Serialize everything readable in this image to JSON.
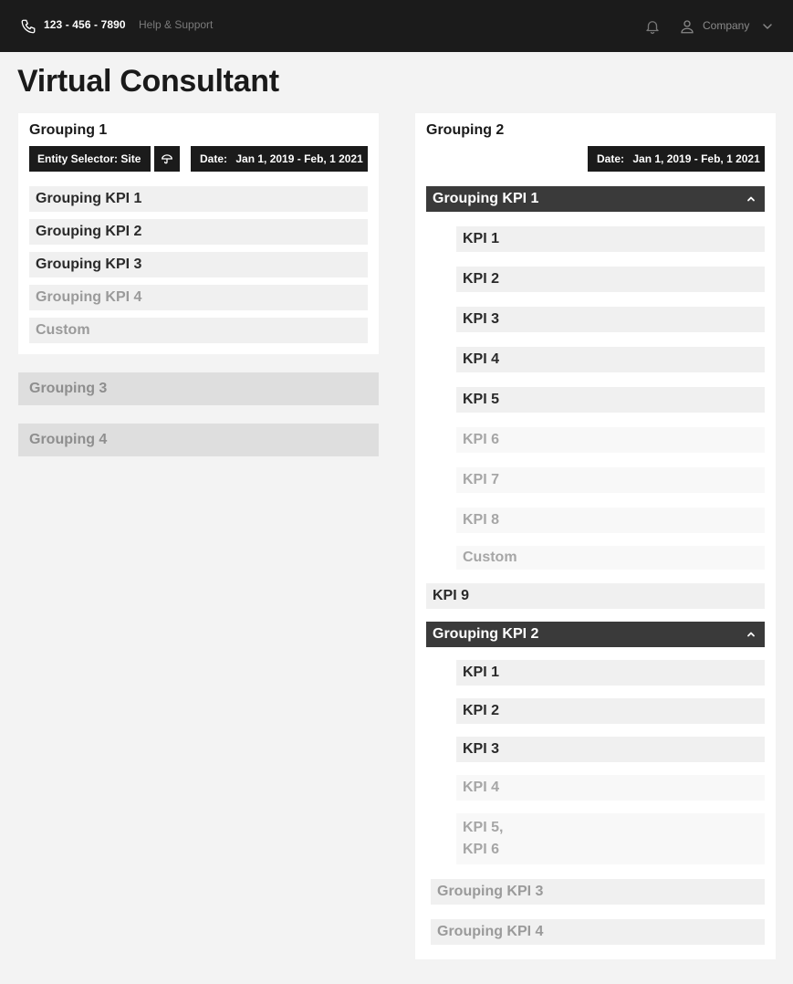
{
  "header": {
    "phone": "123 - 456 - 7890",
    "help": "Help & Support",
    "company": "Company"
  },
  "page": {
    "title": "Virtual Consultant"
  },
  "grouping1": {
    "title": "Grouping 1",
    "entity_selector": "Entity Selector:  Site",
    "date_label": "Date:",
    "date_value": "Jan 1, 2019 - Feb, 1 2021",
    "items": [
      {
        "label": "Grouping KPI 1"
      },
      {
        "label": "Grouping KPI 2"
      },
      {
        "label": "Grouping KPI 3"
      },
      {
        "label": "Grouping KPI 4"
      },
      {
        "label": "Custom"
      }
    ]
  },
  "grouping3": {
    "title": "Grouping 3"
  },
  "grouping4": {
    "title": "Grouping 4"
  },
  "grouping2": {
    "title": "Grouping 2",
    "date_label": "Date:",
    "date_value": "Jan 1, 2019 - Feb, 1 2021",
    "kpi_group_1": {
      "label": "Grouping KPI 1",
      "items": [
        "KPI 1",
        "KPI 2",
        "KPI 3",
        "KPI 4",
        "KPI 5",
        "KPI 6",
        "KPI 7",
        "KPI 8",
        "Custom"
      ]
    },
    "kpi9": "KPI 9",
    "kpi_group_2": {
      "label": "Grouping KPI 2",
      "items": [
        "KPI 1",
        "KPI 2",
        "KPI 3",
        "KPI 4"
      ],
      "multi_line_1": "KPI 5,",
      "multi_line_2": "KPI 6"
    },
    "kpi_group_3": "Grouping KPI 3",
    "kpi_group_4": "Grouping KPI 4"
  },
  "colors": {
    "topbar": "#1b1b1b",
    "chip": "#1b1b1b",
    "expanded_row": "#3a3a3a",
    "background": "#f3f3f3"
  }
}
